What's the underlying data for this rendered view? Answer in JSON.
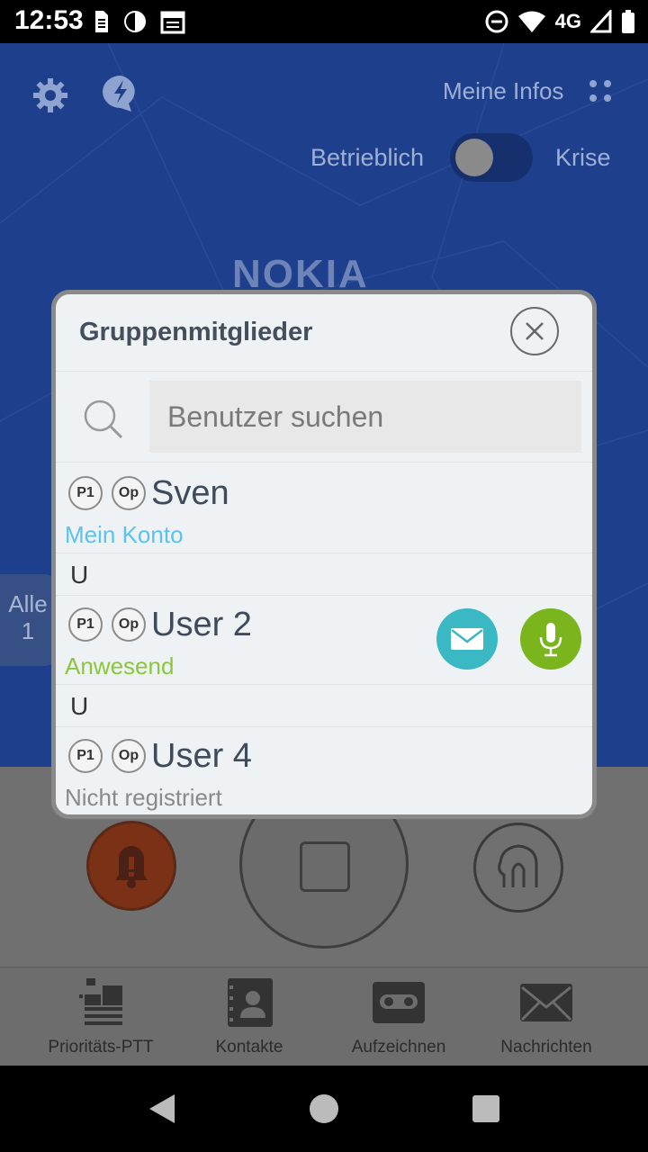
{
  "status_bar": {
    "time": "12:53",
    "network": "4G"
  },
  "header": {
    "my_info_label": "Meine Infos",
    "mode_left": "Betrieblich",
    "mode_right": "Krise",
    "brand": "NOKIA"
  },
  "side_tab": {
    "label": "Alle",
    "count": "1"
  },
  "dialog": {
    "title": "Gruppenmitglieder",
    "search_placeholder": "Benutzer suchen",
    "members": [
      {
        "priority": "P1",
        "role": "Op",
        "name": "Sven",
        "status": "Mein Konto",
        "status_color": "#5cc3ea"
      },
      {
        "priority": "P1",
        "role": "Op",
        "name": "User 2",
        "status": "Anwesend",
        "status_color": "#8cc63e"
      },
      {
        "priority": "P1",
        "role": "Op",
        "name": "User 4",
        "status": "Nicht registriert",
        "status_color": "#8a8a8a"
      }
    ],
    "section_headers": [
      "U",
      "U"
    ],
    "message_button_color": "#3ab8c3",
    "talk_button_color": "#7ab51d"
  },
  "bottom_nav": {
    "items": [
      {
        "label": "Prioritäts-PTT",
        "icon": "priority-ptt-icon"
      },
      {
        "label": "Kontakte",
        "icon": "contacts-icon"
      },
      {
        "label": "Aufzeichnen",
        "icon": "record-icon"
      },
      {
        "label": "Nachrichten",
        "icon": "messages-icon"
      }
    ]
  },
  "colors": {
    "app_blue": "#1e3f8c",
    "alarm": "#7a3116"
  }
}
